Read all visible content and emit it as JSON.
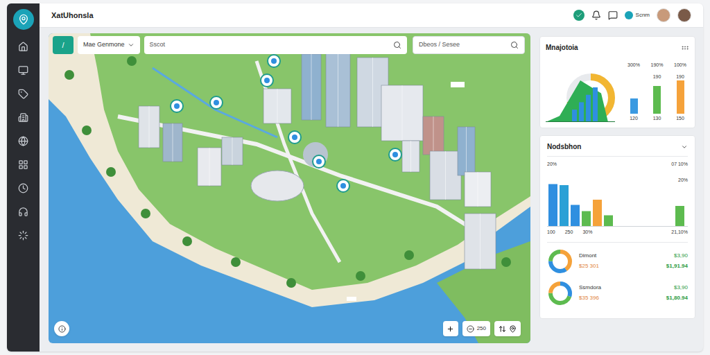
{
  "header": {
    "logo_text": "XatUhonsla",
    "user_label": "Scnm"
  },
  "toolbar": {
    "button": "/",
    "dropdown": "Mae Genmone",
    "search_placeholder": "Sscot",
    "search2_placeholder": "Dbeos / Sesee"
  },
  "map_controls": {
    "zoom": "250"
  },
  "summary_card": {
    "title": "Mnajotoia",
    "area": [
      8,
      55,
      38
    ],
    "bars": [
      25,
      40,
      55,
      70
    ],
    "ring_level": 0.72,
    "columns": [
      {
        "top": "300%",
        "bottom": "120",
        "value": 22,
        "color": "#3b9ae1"
      },
      {
        "top": "190%",
        "mid": "190",
        "bottom": "130",
        "value": 40,
        "color": "#5dbb4f"
      },
      {
        "top": "100%",
        "mid": "190",
        "bottom": "150",
        "value": 48,
        "color": "#f5a23a"
      }
    ]
  },
  "bar_card": {
    "title": "Nodsbhon",
    "top_left": "20%",
    "top_right": "07 10%",
    "right_label": "20%",
    "axis": [
      "100",
      "250",
      "30%",
      "21,10%"
    ],
    "bars": [
      {
        "value": 82,
        "color": "#2f8fe0"
      },
      {
        "value": 80,
        "color": "#2aa0d6"
      },
      {
        "value": 42,
        "color": "#2f8fe0"
      },
      {
        "value": 30,
        "color": "#5dbb4f"
      },
      {
        "value": 52,
        "color": "#f5a23a"
      },
      {
        "value": 22,
        "color": "#5dbb4f"
      },
      {
        "value": 40,
        "color": "#5dbb4f"
      }
    ]
  },
  "donut_rows": [
    {
      "label": "Dimont",
      "amount": "$3,90",
      "sub": "$25 301",
      "total": "$1,91.94",
      "segments": [
        {
          "value": 40,
          "color": "#f5a23a"
        },
        {
          "value": 35,
          "color": "#2f8fe0"
        },
        {
          "value": 25,
          "color": "#5dbb4f"
        }
      ]
    },
    {
      "label": "Ssmdora",
      "amount": "$3,90",
      "sub": "$35 396",
      "total": "$1,80.94",
      "segments": [
        {
          "value": 30,
          "color": "#2f8fe0"
        },
        {
          "value": 45,
          "color": "#5dbb4f"
        },
        {
          "value": 25,
          "color": "#f5a23a"
        }
      ]
    }
  ]
}
